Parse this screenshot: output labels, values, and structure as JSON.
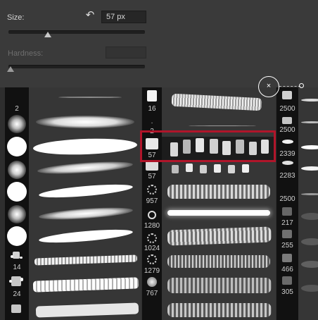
{
  "controls": {
    "size_label": "Size:",
    "size_value": "57 px",
    "reset_icon": "reset-arrow-icon",
    "hardness_label": "Hardness:",
    "size_level_percent": 25,
    "hardness_level_percent": 0
  },
  "cursor": {
    "symbol": "×"
  },
  "brushes": {
    "col1": [
      "2",
      "14",
      "24"
    ],
    "col2": [
      "16",
      "2",
      "57",
      "57",
      "957",
      "1280",
      "1024",
      "1279",
      "767"
    ],
    "col3": [
      "2500",
      "2500",
      "2339",
      "2283",
      "2500",
      "217",
      "255",
      "466",
      "305"
    ]
  },
  "colors": {
    "highlight": "#b0152a"
  }
}
